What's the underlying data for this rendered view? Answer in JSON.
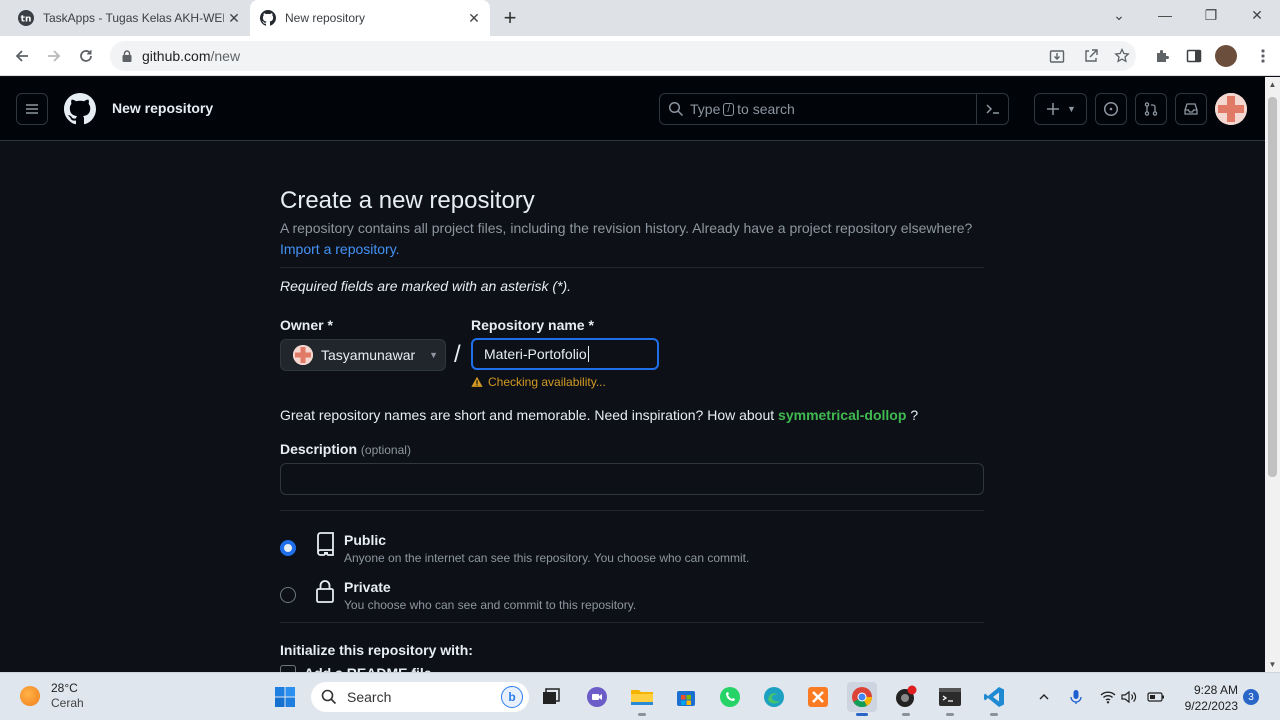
{
  "browser": {
    "tabs": [
      {
        "title": "TaskApps - Tugas Kelas AKH-WEB",
        "active": false
      },
      {
        "title": "New repository",
        "active": true
      }
    ],
    "url_host": "github.com",
    "url_path": "/new"
  },
  "github": {
    "context_title": "New repository",
    "search_prefix": "Type",
    "search_key": "/",
    "search_suffix": "to search"
  },
  "form": {
    "title": "Create a new repository",
    "subtitle": "A repository contains all project files, including the revision history. Already have a project repository elsewhere?",
    "import_link": "Import a repository.",
    "required_note": "Required fields are marked with an asterisk (*).",
    "owner_label": "Owner *",
    "owner_value": "Tasyamunawar",
    "slash": "/",
    "name_label": "Repository name *",
    "name_value": "Materi-Portofolio",
    "checking": "Checking availability...",
    "great_prefix": "Great repository names are short and memorable. Need inspiration? How about",
    "suggestion": "symmetrical-dollop",
    "great_suffix": "?",
    "description_label": "Description",
    "description_optional": "(optional)",
    "description_value": "",
    "visibility": [
      {
        "title": "Public",
        "desc": "Anyone on the internet can see this repository. You choose who can commit.",
        "selected": true
      },
      {
        "title": "Private",
        "desc": "You choose who can see and commit to this repository.",
        "selected": false
      }
    ],
    "init_label": "Initialize this repository with:",
    "readme_label": "Add a README file"
  },
  "taskbar": {
    "temp": "28°C",
    "weather": "Cerah",
    "search_placeholder": "Search",
    "time": "9:28 AM",
    "date": "9/22/2023",
    "notifications": "3"
  },
  "colors": {
    "accent": "#1f6feb",
    "link": "#4493f8",
    "success": "#3fb950",
    "warning": "#d29922",
    "bg": "#0d1117"
  }
}
